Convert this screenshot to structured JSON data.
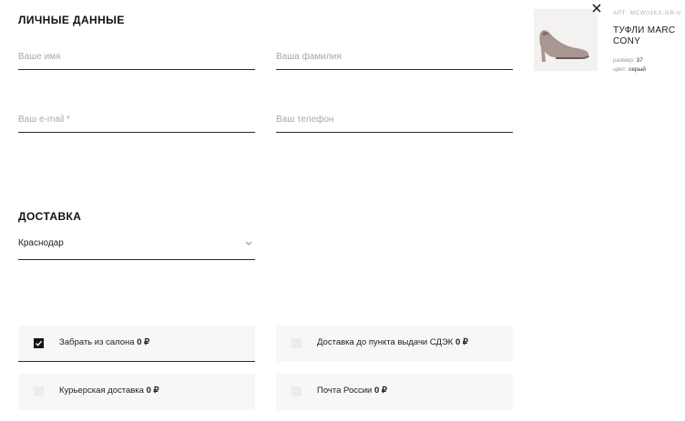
{
  "personal": {
    "title": "ЛИЧНЫЕ ДАННЫЕ",
    "first_name_placeholder": "Ваше имя",
    "last_name_placeholder": "Ваша фамилия",
    "email_placeholder": "Ваш e-mail *",
    "phone_placeholder": "Ваш телефон"
  },
  "delivery": {
    "title": "ДОСТАВКА",
    "city": "Краснодар",
    "options": [
      {
        "label": "Забрать из салона",
        "price": "0 ₽",
        "checked": true
      },
      {
        "label": "Доставка до пункта выдачи СДЭК",
        "price": "0 ₽",
        "checked": false
      },
      {
        "label": "Курьерская доставка",
        "price": "0 ₽",
        "checked": false
      },
      {
        "label": "Почта России",
        "price": "0 ₽",
        "checked": false
      }
    ]
  },
  "product": {
    "article": "АРТ: MCW01KX-GR-V",
    "name": "ТУФЛИ MARC CONY",
    "size_label": "размер:",
    "size_value": "37",
    "color_label": "цвет:",
    "color_value": "серый",
    "close_icon": "close-icon"
  },
  "colors": {
    "text": "#1a1a1a",
    "placeholder": "#a8a8a8",
    "option_bg": "#f7f7f7",
    "checkbox_checked": "#151515",
    "shoe": "#a99690"
  }
}
